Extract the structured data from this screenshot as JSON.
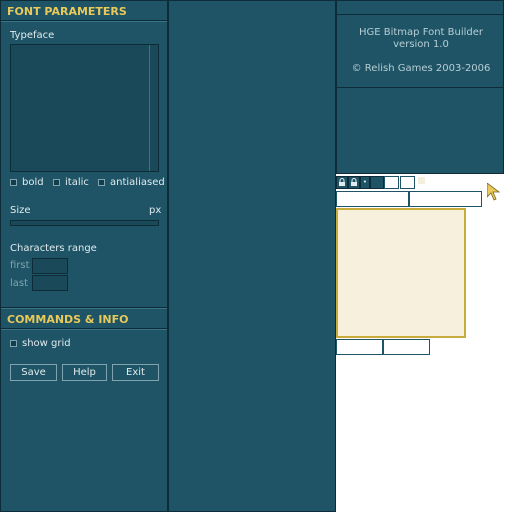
{
  "font_params": {
    "title": "FONT PARAMETERS",
    "typeface_label": "Typeface",
    "bold_label": "bold",
    "italic_label": "italic",
    "antialiased_label": "antialiased",
    "size_label": "Size",
    "size_unit": "px",
    "range_label": "Characters range",
    "first_label": "first",
    "last_label": "last"
  },
  "commands": {
    "title": "COMMANDS & INFO",
    "show_grid_label": "show grid",
    "save_label": "Save",
    "help_label": "Help",
    "exit_label": "Exit"
  },
  "about": {
    "app_name": "HGE Bitmap Font Builder",
    "version": "version 1.0",
    "copyright": "© Relish Games 2003-2006"
  },
  "toolbar": {
    "icons": [
      "lock-icon",
      "lock-icon",
      "dot-icon"
    ],
    "dot_glyph": "•"
  },
  "colors": {
    "panel": "#1e5466",
    "accent_title": "#e8c95a",
    "preview_fill": "#f6f0dc",
    "preview_border": "#c9ab3c"
  }
}
